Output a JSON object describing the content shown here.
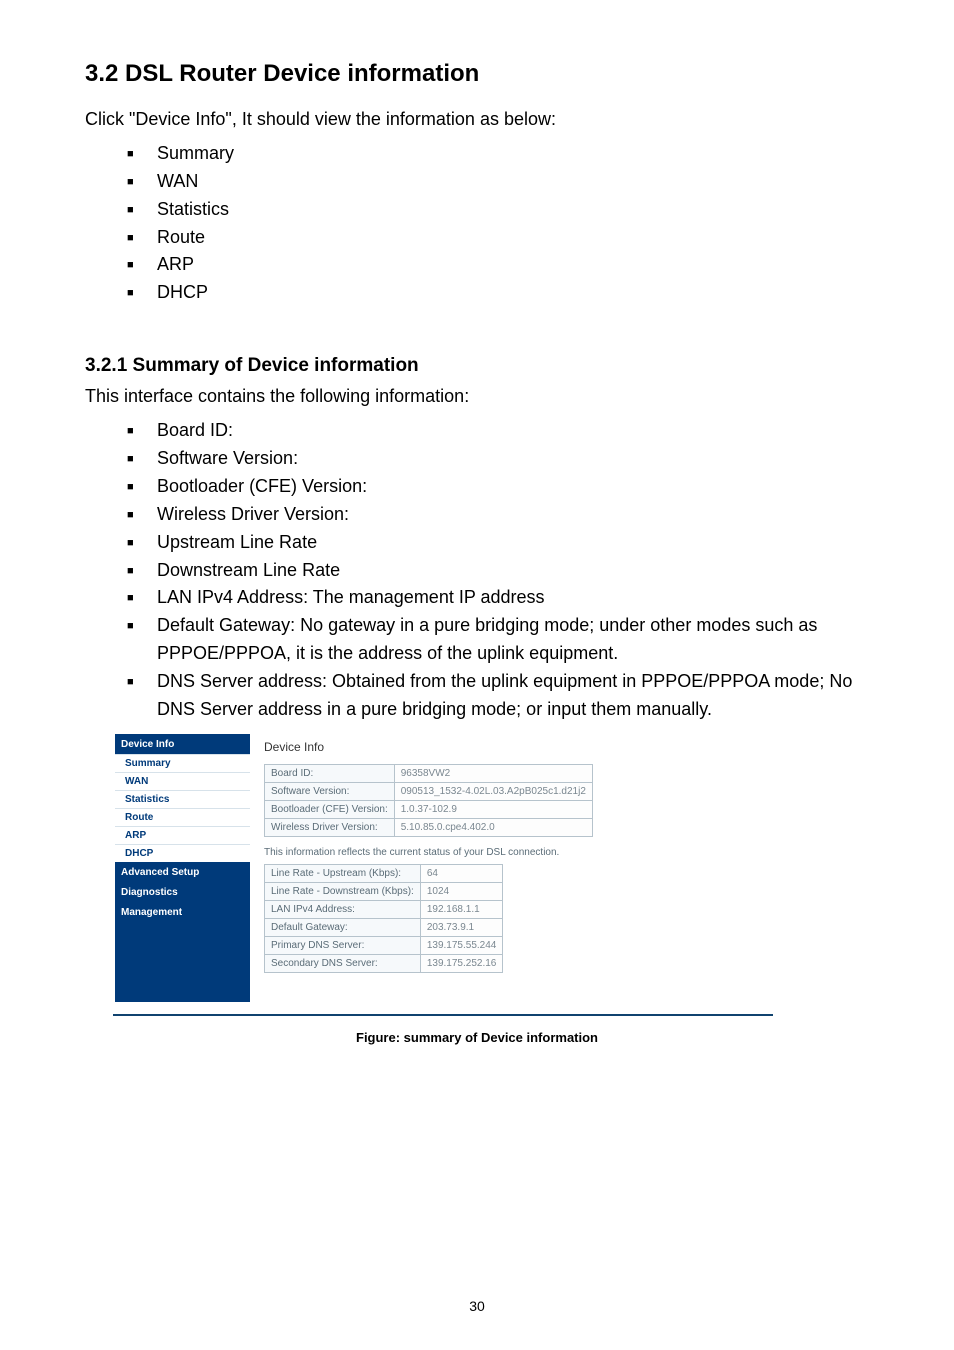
{
  "heading2": "3.2 DSL Router Device information",
  "intro1": "Click \"Device Info\", It should view the information as below:",
  "list1": [
    "Summary",
    "WAN",
    "Statistics",
    "Route",
    "ARP",
    "DHCP"
  ],
  "heading3": "3.2.1 Summary of Device information",
  "intro2": "This interface contains the following information:",
  "list2": [
    "Board ID:",
    "Software Version:",
    "Bootloader (CFE) Version:",
    "Wireless Driver Version:",
    "Upstream Line Rate",
    "Downstream Line Rate",
    "LAN IPv4 Address: The management IP address",
    "Default Gateway: No gateway in a pure bridging mode; under other modes such as PPPOE/PPPOA, it is the address of the uplink equipment.",
    "DNS Server address: Obtained from the uplink equipment in PPPOE/PPPOA mode; No DNS Server address in a pure bridging mode; or input them manually."
  ],
  "sidebar": {
    "header1": "Device Info",
    "items1": [
      "Summary",
      "WAN",
      "Statistics",
      "Route",
      "ARP",
      "DHCP"
    ],
    "header2": "Advanced Setup",
    "header3": "Diagnostics",
    "header4": "Management"
  },
  "panel": {
    "title": "Device Info",
    "table1": [
      [
        "Board ID:",
        "96358VW2"
      ],
      [
        "Software Version:",
        "090513_1532-4.02L.03.A2pB025c1.d21j2"
      ],
      [
        "Bootloader (CFE) Version:",
        "1.0.37-102.9"
      ],
      [
        "Wireless Driver Version:",
        "5.10.85.0.cpe4.402.0"
      ]
    ],
    "note": "This information reflects the current status of your DSL connection.",
    "table2": [
      [
        "Line Rate - Upstream (Kbps):",
        "64"
      ],
      [
        "Line Rate - Downstream (Kbps):",
        "1024"
      ],
      [
        "LAN IPv4 Address:",
        "192.168.1.1"
      ],
      [
        "Default Gateway:",
        "203.73.9.1"
      ],
      [
        "Primary DNS Server:",
        "139.175.55.244"
      ],
      [
        "Secondary DNS Server:",
        "139.175.252.16"
      ]
    ]
  },
  "caption": "Figure: summary of Device information",
  "pagenum": "30"
}
